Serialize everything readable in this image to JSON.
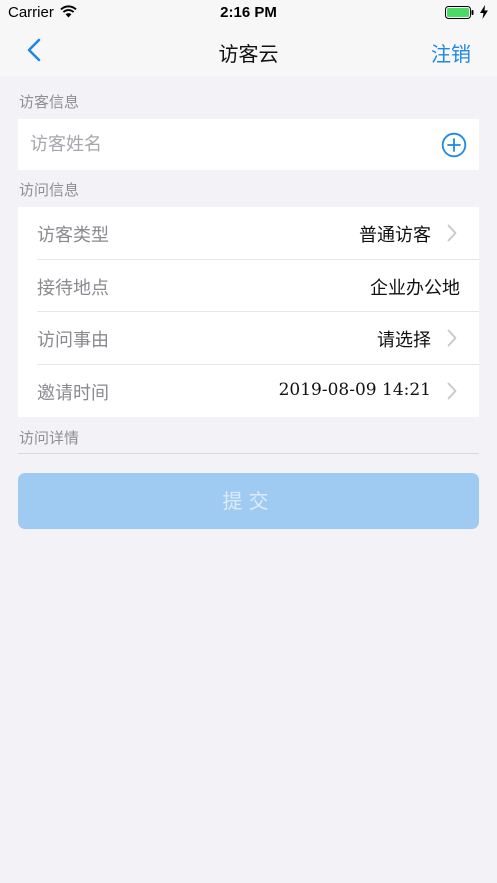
{
  "status_bar": {
    "carrier": "Carrier",
    "time": "2:16 PM"
  },
  "nav": {
    "title": "访客云",
    "right_action": "注销",
    "back_icon": "chevron-left-icon"
  },
  "visitor_section": {
    "header": "访客信息",
    "name_placeholder": "访客姓名",
    "name_value": "",
    "add_icon": "plus-circle-icon"
  },
  "visit_section": {
    "header": "访问信息",
    "rows": [
      {
        "label": "访客类型",
        "value": "普通访客",
        "has_arrow": true
      },
      {
        "label": "接待地点",
        "value": "企业办公地",
        "has_arrow": false
      },
      {
        "label": "访问事由",
        "value": "请选择",
        "has_arrow": true
      },
      {
        "label": "邀请时间",
        "value": "2019-08-09 14:21",
        "has_arrow": true
      }
    ]
  },
  "detail_section": {
    "header": "访问详情"
  },
  "submit": {
    "label": "提交",
    "enabled": false
  },
  "colors": {
    "accent": "#1e88e5",
    "background": "#f2f2f7",
    "submit_disabled": "#9fcbf2"
  }
}
